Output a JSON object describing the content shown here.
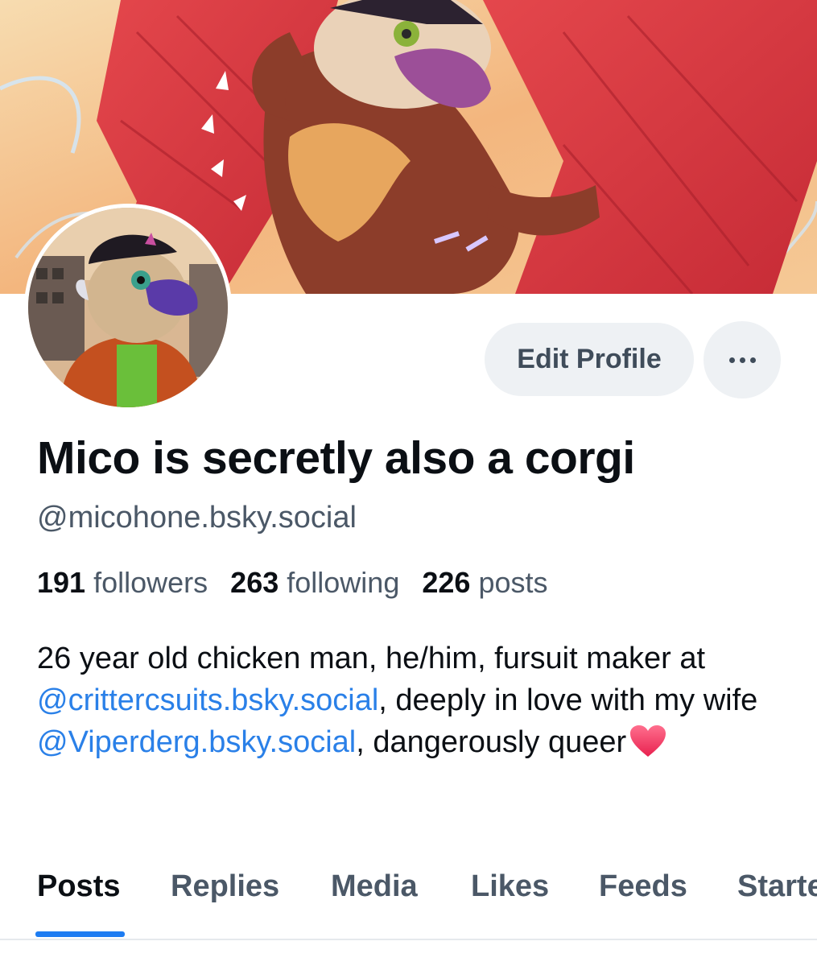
{
  "profile": {
    "display_name": "Mico is secretly also a corgi",
    "handle": "@micohone.bsky.social",
    "edit_button_label": "Edit Profile",
    "more_icon": "ellipsis-icon"
  },
  "stats": {
    "followers_count": "191",
    "followers_label": "followers",
    "following_count": "263",
    "following_label": "following",
    "posts_count": "226",
    "posts_label": "posts"
  },
  "bio": {
    "part1": "26 year old chicken man, he/him, fursuit maker at ",
    "mention1": "@crittercsuits.bsky.social",
    "part2": ", deeply in love with my wife ",
    "mention2": "@Viperderg.bsky.social",
    "part3": ", dangerously queer",
    "emoji": "heart-icon"
  },
  "tabs": [
    {
      "label": "Posts",
      "active": true
    },
    {
      "label": "Replies",
      "active": false
    },
    {
      "label": "Media",
      "active": false
    },
    {
      "label": "Likes",
      "active": false
    },
    {
      "label": "Feeds",
      "active": false
    },
    {
      "label": "Starte",
      "active": false
    }
  ],
  "colors": {
    "accent": "#1d7cf2",
    "link": "#2a80e8",
    "muted_text": "#4b5867",
    "button_bg": "#eef1f4"
  }
}
